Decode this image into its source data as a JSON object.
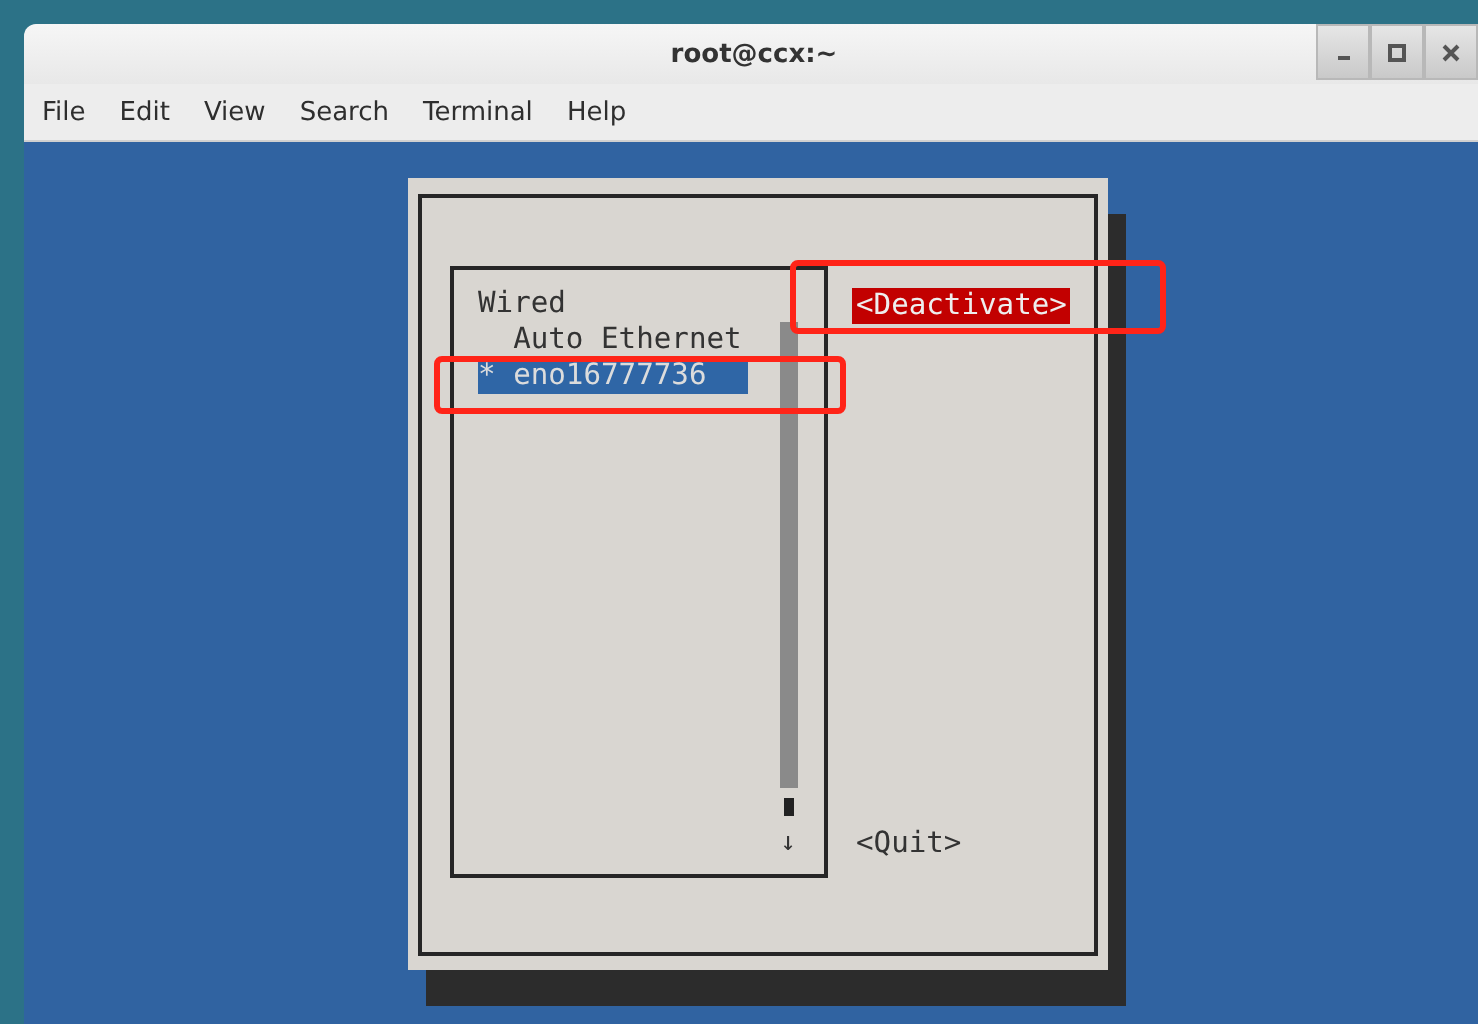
{
  "window": {
    "title": "root@ccx:~"
  },
  "menu": [
    "File",
    "Edit",
    "View",
    "Search",
    "Terminal",
    "Help"
  ],
  "connection_list": {
    "groups": [
      {
        "label": "Wired",
        "children": [
          {
            "label": "Auto Ethernet",
            "selected": false
          },
          {
            "label": "eno16777736",
            "marker": "*",
            "selected": true
          }
        ]
      }
    ],
    "scroll_arrow": "↓"
  },
  "buttons": [
    {
      "label": "<Deactivate>",
      "focused": true
    },
    {
      "label": "<Quit>",
      "focused": false
    }
  ]
}
